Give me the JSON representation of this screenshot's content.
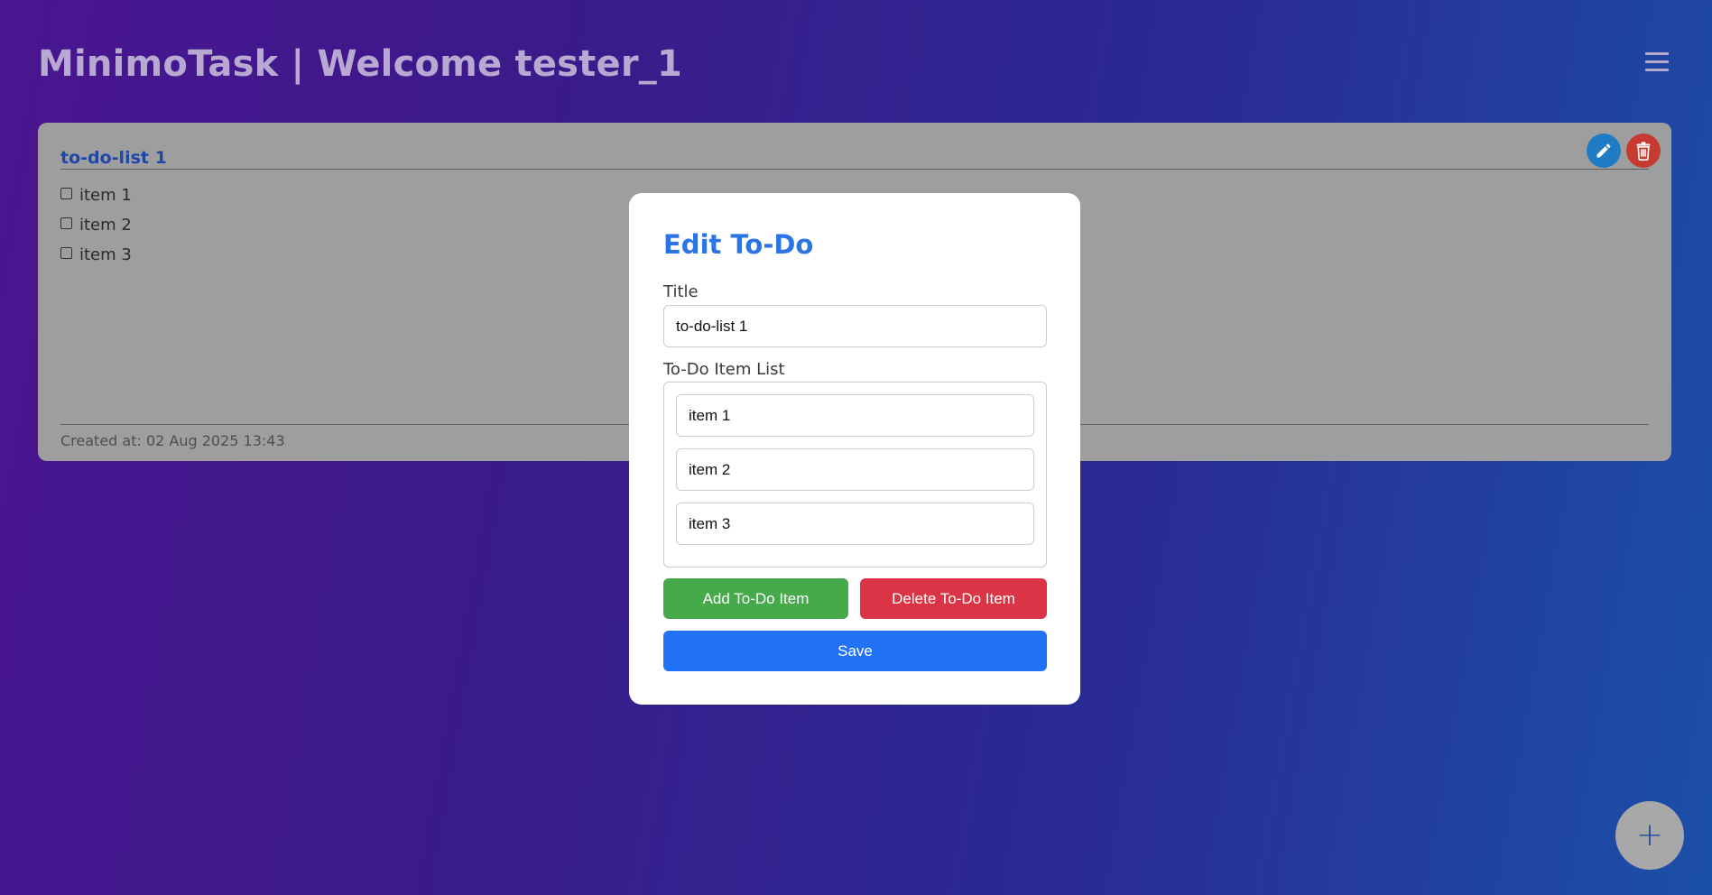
{
  "header": {
    "title": "MinimoTask | Welcome tester_1"
  },
  "menu": {
    "icon": "hamburger-menu-icon"
  },
  "card": {
    "title": "to-do-list 1",
    "items": [
      {
        "label": "item 1",
        "checked": false
      },
      {
        "label": "item 2",
        "checked": false
      },
      {
        "label": "item 3",
        "checked": false
      }
    ],
    "created_at": "Created at: 02 Aug 2025 13:43",
    "edit_icon": "pencil-icon",
    "delete_icon": "trash-icon"
  },
  "fab": {
    "label": "+"
  },
  "modal": {
    "title": "Edit To-Do",
    "title_label": "Title",
    "title_value": "to-do-list 1",
    "list_label": "To-Do Item List",
    "items": [
      "item 1",
      "item 2",
      "item 3"
    ],
    "add_label": "Add To-Do Item",
    "delete_label": "Delete To-Do Item",
    "save_label": "Save"
  },
  "colors": {
    "accent_blue": "#2272f6",
    "add_green": "#46aa4a",
    "delete_red": "#dc3447",
    "edit_blue": "#1f7cc4",
    "trash_red": "#c63a32"
  }
}
